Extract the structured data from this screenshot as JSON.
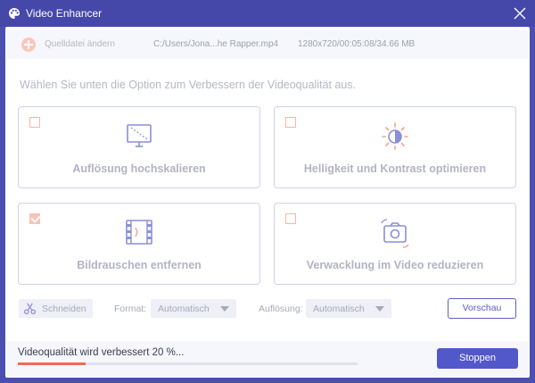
{
  "window": {
    "title": "Video Enhancer",
    "app_icon": "palette-icon",
    "close_icon": "close-icon"
  },
  "file": {
    "change_label": "Quelldatei ändern",
    "path": "C:/Users/Jona...he Rapper.mp4",
    "meta": "1280x720/00:05:08/34.66 MB"
  },
  "instruction": "Wählen Sie unten die Option zum Verbessern der Videoqualität aus.",
  "options": [
    {
      "label": "Auflösung hochskalieren",
      "checked": false,
      "icon": "monitor-icon"
    },
    {
      "label": "Helligkeit und Kontrast optimieren",
      "checked": false,
      "icon": "brightness-icon"
    },
    {
      "label": "Bildrauschen entfernen",
      "checked": true,
      "icon": "film-icon"
    },
    {
      "label": "Verwacklung im Video reduzieren",
      "checked": false,
      "icon": "camera-stabilize-icon"
    }
  ],
  "toolbar": {
    "cut_label": "Schneiden",
    "format_label": "Format:",
    "format_value": "Automatisch",
    "resolution_label": "Auflösung:",
    "resolution_value": "Automatisch",
    "preview_label": "Vorschau"
  },
  "progress": {
    "text": "Videoqualität wird verbessert 20 %...",
    "percent": 20,
    "stop_label": "Stoppen"
  },
  "colors": {
    "frame": "#4547a9",
    "accent": "#5257c9",
    "progress": "#f26b50",
    "checkbox": "#f7c3b8"
  }
}
